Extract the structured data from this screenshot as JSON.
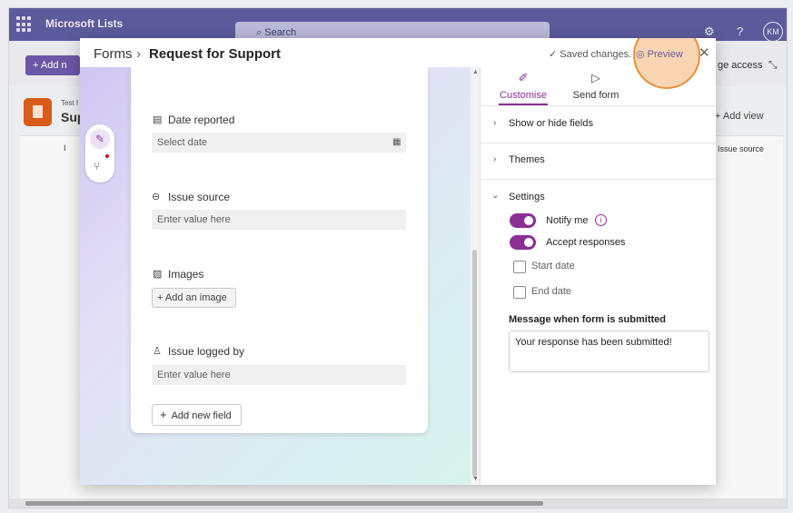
{
  "app": {
    "name": "Microsoft Lists",
    "search_placeholder": "Search",
    "avatar_initials": "KM",
    "help_label": "?",
    "add_new_label": "+ Add n",
    "list_small": "Test I",
    "list_big": "Sup",
    "col_partial": "I",
    "add_view_label": "+ Add view",
    "manage_access_label": "ge access",
    "issue_source_col": "Issue source"
  },
  "modal": {
    "breadcrumb_root": "Forms",
    "breadcrumb_sep": "›",
    "breadcrumb_current": "Request for Support",
    "saved_label": "✓ Saved changes.",
    "preview_label": "Preview",
    "close_label": "✕"
  },
  "form": {
    "fields": [
      {
        "label": "Date reported",
        "icon": "calendar-icon",
        "placeholder": "Select date"
      },
      {
        "label": "Issue source",
        "icon": "link-icon",
        "placeholder": "Enter value here"
      },
      {
        "label": "Images",
        "icon": "image-icon",
        "button": "+ Add an image"
      },
      {
        "label": "Issue logged by",
        "icon": "person-icon",
        "placeholder": "Enter value here"
      }
    ],
    "add_field_label": "Add new field",
    "add_field_plus": "+"
  },
  "panel": {
    "tabs": [
      {
        "label": "Customise",
        "icon": "customise-icon",
        "active": true
      },
      {
        "label": "Send form",
        "icon": "send-icon",
        "active": false
      }
    ],
    "sections": [
      {
        "title": "Show or hide fields",
        "expanded": false
      },
      {
        "title": "Themes",
        "expanded": false
      },
      {
        "title": "Settings",
        "expanded": true
      }
    ],
    "settings": {
      "notify_me": "Notify me",
      "accept_responses": "Accept responses",
      "start_date": "Start date",
      "end_date": "End date",
      "message_label": "Message when form is submitted",
      "message_value": "Your response has been submitted!",
      "notify_on": true,
      "accept_on": true
    }
  },
  "colors": {
    "accent": "#8b2f95",
    "suite_bar": "#5b5b9c",
    "highlight": "#f0963c"
  }
}
